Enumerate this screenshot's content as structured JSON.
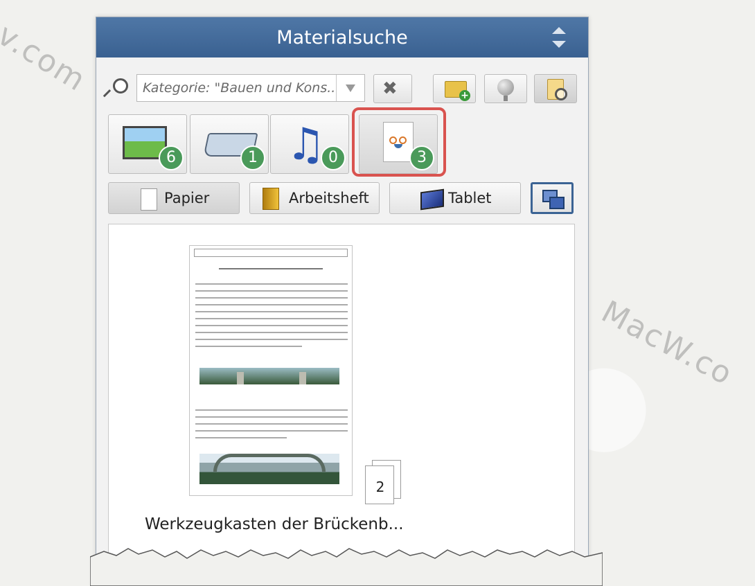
{
  "watermark": {
    "left": "v.com",
    "right": "MacW.co"
  },
  "panel": {
    "title": "Materialsuche"
  },
  "search": {
    "category_value": "Kategorie: \"Bauen und Kons..."
  },
  "type_tabs": [
    {
      "name": "images",
      "icon": "image-icon",
      "count": "6"
    },
    {
      "name": "books",
      "icon": "book-icon",
      "count": "1"
    },
    {
      "name": "audio",
      "icon": "music-note-icon",
      "count": "0"
    },
    {
      "name": "worksheets",
      "icon": "worksheet-icon",
      "count": "3",
      "active": true
    }
  ],
  "formats": {
    "paper": "Papier",
    "workbook": "Arbeitsheft",
    "tablet": "Tablet",
    "active": "paper"
  },
  "results": [
    {
      "title": "Werkzeugkasten der Brückenb...",
      "pages": "2"
    }
  ],
  "colors": {
    "header": "#4a6f9c",
    "badge": "#4a9a5a",
    "highlight": "#d9534f"
  }
}
